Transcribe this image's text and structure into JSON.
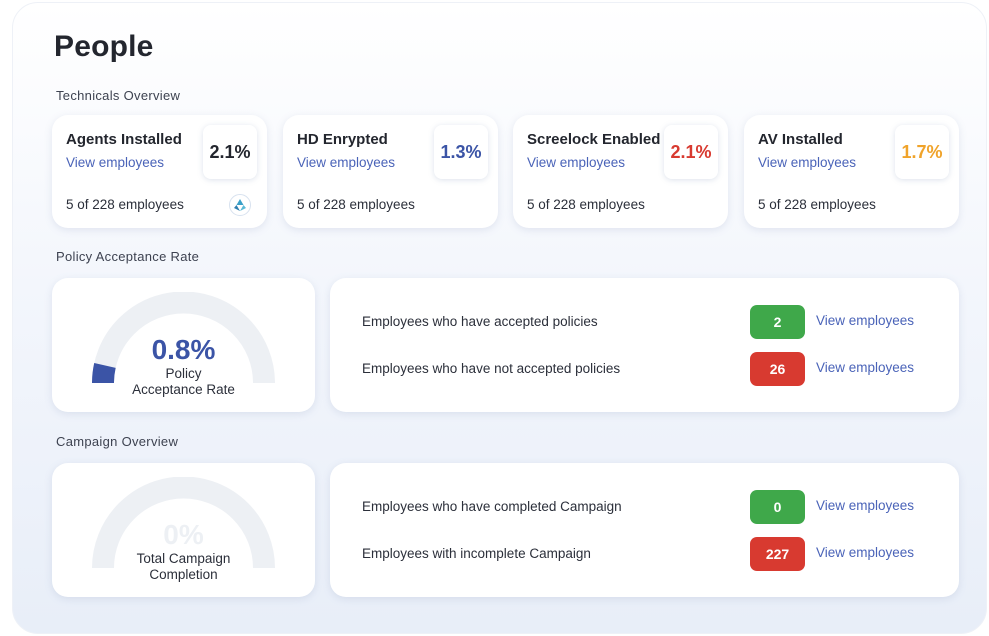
{
  "page": {
    "title": "People"
  },
  "colors": {
    "link": "#4a63b8",
    "blue": "#3b54a6",
    "red": "#d83a30",
    "orange": "#f0a32a",
    "green": "#3fa84a",
    "dark": "#23262e"
  },
  "technicals": {
    "section_label": "Technicals Overview",
    "cards": [
      {
        "title": "Agents Installed",
        "link": "View employees",
        "percent": "2.1%",
        "percent_color": "#23262e",
        "count": "5 of 228 employees",
        "icon": "refresh-cycle-icon"
      },
      {
        "title": "HD Enrypted",
        "link": "View employees",
        "percent": "1.3%",
        "percent_color": "#3b54a6",
        "count": "5 of 228 employees"
      },
      {
        "title": "Screelock Enabled",
        "link": "View employees",
        "percent": "2.1%",
        "percent_color": "#d83a30",
        "count": "5 of 228 employees"
      },
      {
        "title": "AV Installed",
        "link": "View employees",
        "percent": "1.7%",
        "percent_color": "#f0a32a",
        "count": "5 of 228 employees"
      }
    ]
  },
  "policy": {
    "section_label": "Policy Acceptance Rate",
    "gauge": {
      "value": "0.8%",
      "fraction": 0.008,
      "caption_line1": "Policy",
      "caption_line2": "Acceptance Rate"
    },
    "rows": [
      {
        "label": "Employees who have accepted policies",
        "value": "2",
        "badge_color": "#3fa84a",
        "link": "View employees"
      },
      {
        "label": "Employees who have not accepted policies",
        "value": "26",
        "badge_color": "#d83a30",
        "link": "View employees"
      }
    ]
  },
  "campaign": {
    "section_label": "Campaign Overview",
    "gauge": {
      "value": "0%",
      "fraction": 0,
      "caption_line1": "Total Campaign",
      "caption_line2": "Completion"
    },
    "rows": [
      {
        "label": "Employees who have completed Campaign",
        "value": "0",
        "badge_color": "#3fa84a",
        "link": "View employees"
      },
      {
        "label": "Employees with incomplete Campaign",
        "value": "227",
        "badge_color": "#d83a30",
        "link": "View employees"
      }
    ]
  }
}
